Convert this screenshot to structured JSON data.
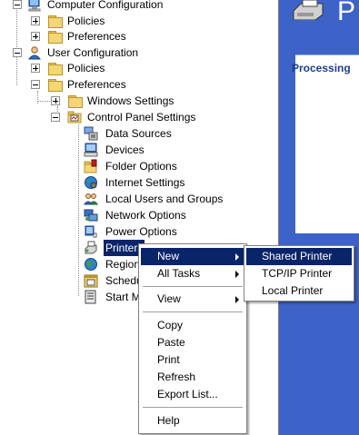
{
  "tree": {
    "items": [
      {
        "label": "Computer Configuration"
      },
      {
        "label": "Policies"
      },
      {
        "label": "Preferences"
      },
      {
        "label": "User Configuration"
      },
      {
        "label": "Policies"
      },
      {
        "label": "Preferences"
      },
      {
        "label": "Windows Settings"
      },
      {
        "label": "Control Panel Settings"
      },
      {
        "label": "Data Sources"
      },
      {
        "label": "Devices"
      },
      {
        "label": "Folder Options"
      },
      {
        "label": "Internet Settings"
      },
      {
        "label": "Local Users and Groups"
      },
      {
        "label": "Network Options"
      },
      {
        "label": "Power Options"
      },
      {
        "label": "Printers"
      },
      {
        "label": "Regional"
      },
      {
        "label": "Scheduled"
      },
      {
        "label": "Start Menu"
      }
    ]
  },
  "right_panel": {
    "header_letter": "P",
    "card_title": "Processing"
  },
  "context_menu": {
    "items": [
      {
        "label": "New"
      },
      {
        "label": "All Tasks"
      },
      {
        "label": "View"
      },
      {
        "label": "Copy"
      },
      {
        "label": "Paste"
      },
      {
        "label": "Print"
      },
      {
        "label": "Refresh"
      },
      {
        "label": "Export List..."
      },
      {
        "label": "Help"
      }
    ]
  },
  "submenu_new": {
    "items": [
      {
        "label": "Shared Printer"
      },
      {
        "label": "TCP/IP Printer"
      },
      {
        "label": "Local Printer"
      }
    ]
  },
  "colors": {
    "selection": "#0a246a",
    "right_panel_bg": "#3e63c8"
  },
  "icons": {
    "computer_configuration": "computer-icon",
    "user_configuration": "user-icon",
    "folder": "folder-icon",
    "control_panel": "control-panel-icon",
    "data_sources": "data-sources-icon",
    "devices": "devices-icon",
    "folder_options": "folder-options-icon",
    "internet_settings": "internet-settings-icon",
    "local_users": "local-users-icon",
    "network_options": "network-options-icon",
    "power_options": "power-options-icon",
    "printers": "printer-icon",
    "regional": "globe-icon",
    "scheduled": "scheduled-tasks-icon",
    "start_menu": "start-menu-icon"
  }
}
